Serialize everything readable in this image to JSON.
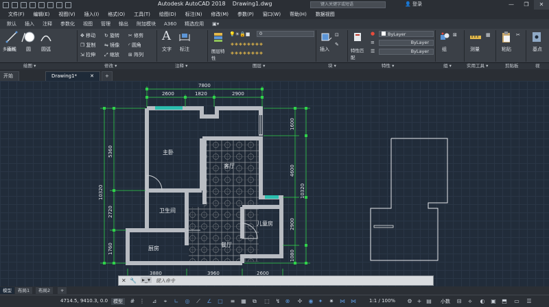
{
  "app": {
    "title": "Autodesk AutoCAD 2018",
    "document": "Drawing1.dwg",
    "search_placeholder": "键入关键字或短语",
    "login_label": "登录",
    "min_glyph": "—",
    "max_glyph": "❐",
    "close_glyph": "✕"
  },
  "menu": [
    "文件(F)",
    "编辑(E)",
    "视图(V)",
    "插入(I)",
    "格式(O)",
    "工具(T)",
    "绘图(D)",
    "标注(N)",
    "修改(M)",
    "参数(P)",
    "窗口(W)",
    "帮助(H)",
    "数据视图"
  ],
  "ribbon_tabs": [
    "默认",
    "插入",
    "注释",
    "参数化",
    "视图",
    "管理",
    "输出",
    "附加模块",
    "A360",
    "精选应用"
  ],
  "ribbon": {
    "line_label": "直线",
    "polyline_label": "多段线",
    "circle_label": "圆",
    "arc_label": "圆弧",
    "move_label": "移动",
    "rotate_label": "旋转",
    "trim_label": "修剪",
    "copy_label": "复制",
    "mirror_label": "镜像",
    "fillet_label": "圆角",
    "stretch_label": "拉伸",
    "scale_label": "缩放",
    "array_label": "阵列",
    "text_label": "文字",
    "dimension_label": "标注",
    "layer_props_label": "图层特性",
    "layer_name": "0",
    "insert_label": "插入",
    "match_props_label": "特性匹配",
    "bylayer_1": "ByLayer",
    "bylayer_2": "ByLayer",
    "bylayer_3": "ByLayer",
    "group_label": "组",
    "measure_label": "测量",
    "paste_label": "粘贴",
    "base_label": "基点"
  },
  "panels": [
    "绘图",
    "修改",
    "注释",
    "图层",
    "块",
    "特性",
    "组",
    "实用工具",
    "剪贴板",
    "视"
  ],
  "doc_tabs": {
    "start": "开始",
    "drawing": "Drawing1*",
    "add": "+"
  },
  "plan": {
    "rooms": {
      "master_bedroom": "主卧",
      "living_room": "客厅",
      "bathroom": "卫生间",
      "kids_room": "儿童房",
      "kitchen": "厨房",
      "dining_room": "餐厅"
    },
    "dims_top": {
      "overall": "7800",
      "a": "2600",
      "b": "1820",
      "c": "2900"
    },
    "dims_left": {
      "overall": "10320",
      "a": "5360",
      "b": "2720",
      "c": "1760"
    },
    "dims_right": {
      "overall": "10320",
      "a": "1600",
      "b": "4600",
      "c": "2900",
      "d": "1080"
    },
    "dims_bottom": {
      "overall": "10880",
      "a": "3880",
      "b": "3960",
      "c": "2600"
    }
  },
  "command": {
    "close_glyph": "✕",
    "wrench_glyph": "🔧",
    "placeholder": "键入命令"
  },
  "layout_tabs": [
    "模型",
    "布局1",
    "布局2",
    "+"
  ],
  "status": {
    "coords": "4714.5, 9410.3, 0.0",
    "model_label": "模型",
    "scale": "1:1 / 100%",
    "units": "小数"
  },
  "colors": {
    "canvas": "#212c3a",
    "walls": "#b8bcc2",
    "dims": "#2fd24a",
    "accent": "#5c95d6"
  }
}
